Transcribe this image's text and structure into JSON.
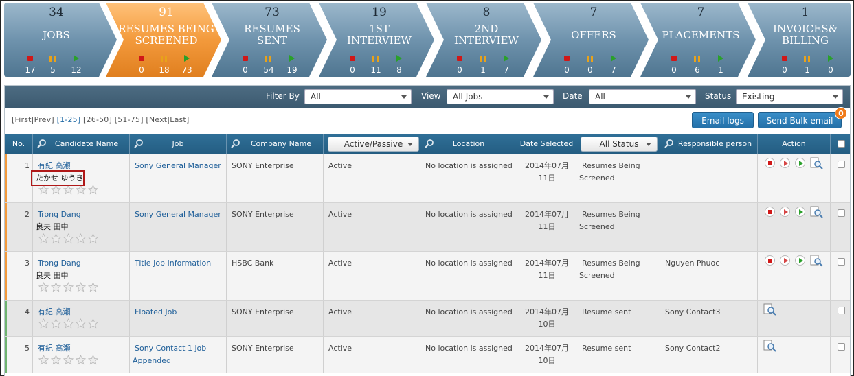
{
  "pipeline": [
    {
      "count": "34",
      "title": "JOBS",
      "stop": "17",
      "pause": "5",
      "play": "12"
    },
    {
      "count": "91",
      "title": "RESUMES BEING SCREENED",
      "title_l1": "RESUMES BEING",
      "title_l2": "SCREENED",
      "stop": "0",
      "pause": "18",
      "play": "73"
    },
    {
      "count": "73",
      "title_l1": "RESUMES",
      "title_l2": "SENT",
      "stop": "0",
      "pause": "54",
      "play": "19"
    },
    {
      "count": "19",
      "title_l1": "1ST",
      "title_l2": "INTERVIEW",
      "stop": "0",
      "pause": "11",
      "play": "8"
    },
    {
      "count": "8",
      "title_l1": "2ND",
      "title_l2": "INTERVIEW",
      "stop": "0",
      "pause": "1",
      "play": "7"
    },
    {
      "count": "7",
      "title": "OFFERS",
      "stop": "0",
      "pause": "0",
      "play": "7"
    },
    {
      "count": "7",
      "title": "PLACEMENTS",
      "stop": "0",
      "pause": "6",
      "play": "1"
    },
    {
      "count": "1",
      "title_l1": "INVOICES&",
      "title_l2": "BILLING",
      "stop": "0",
      "pause": "1",
      "play": "0"
    }
  ],
  "filters": {
    "filter_by_label": "Filter By",
    "filter_by_value": "All",
    "view_label": "View",
    "view_value": "All Jobs",
    "date_label": "Date",
    "date_value": "All",
    "status_label": "Status",
    "status_value": "Existing"
  },
  "pager": {
    "first": "First",
    "prev": "Prev",
    "p1": "1-25",
    "p2": "26-50",
    "p3": "51-75",
    "next": "Next",
    "last": "Last"
  },
  "buttons": {
    "email_logs": "Email logs",
    "send_bulk": "Send Bulk email",
    "bulk_badge": "0"
  },
  "columns": {
    "no": "No.",
    "candidate": "Candidate Name",
    "job": "Job",
    "company": "Company Name",
    "active_passive": "Active/Passive",
    "location": "Location",
    "date": "Date Selected",
    "all_status": "All Status",
    "responsible": "Responsible person",
    "action": "Action"
  },
  "rows": [
    {
      "no": "1",
      "name": "有紀 高瀬",
      "sub": "たかせ ゆうき",
      "job": "Sony General Manager",
      "job2": "",
      "company": "SONY Enterprise",
      "ap": "Active",
      "location": "No location is assigned",
      "date1": "2014年07月",
      "date2": "11日",
      "status1": "Resumes Being",
      "status2": "Screened",
      "person": ""
    },
    {
      "no": "2",
      "name": "Trong Dang",
      "sub": "良夫 田中",
      "job": "Sony General Manager",
      "job2": "",
      "company": "SONY Enterprise",
      "ap": "Active",
      "location": "No location is assigned",
      "date1": "2014年07月",
      "date2": "11日",
      "status1": "Resumes Being",
      "status2": "Screened",
      "person": ""
    },
    {
      "no": "3",
      "name": "Trong Dang",
      "sub": "良夫 田中",
      "job": "Title Job Information",
      "job2": "",
      "company": "HSBC Bank",
      "ap": "Active",
      "location": "No location is assigned",
      "date1": "2014年07月",
      "date2": "11日",
      "status1": "Resumes Being",
      "status2": "Screened",
      "person": "Nguyen Phuoc"
    },
    {
      "no": "4",
      "name": "有紀 高瀬",
      "sub": "",
      "job": "Floated Job",
      "job2": "",
      "company": "SONY Enterprise",
      "ap": "Active",
      "location": "No location is assigned",
      "date1": "2014年07月",
      "date2": "10日",
      "status1": "Resume sent",
      "status2": "",
      "person": "Sony Contact3"
    },
    {
      "no": "5",
      "name": "有紀 高瀬",
      "sub": "",
      "job": "Sony Contact 1 job",
      "job2": "Appended",
      "company": "SONY Enterprise",
      "ap": "Active",
      "location": "No location is assigned",
      "date1": "2014年07月",
      "date2": "10日",
      "status1": "Resume sent",
      "status2": "",
      "person": "Sony Contact2"
    }
  ],
  "colors": {
    "stage": "#6f93ad",
    "stage_active": "#f39a3c",
    "header": "#2a6690",
    "accent_orange": "#f07a1a",
    "accent_green": "#2aa02a",
    "highlight": "#b01818"
  }
}
